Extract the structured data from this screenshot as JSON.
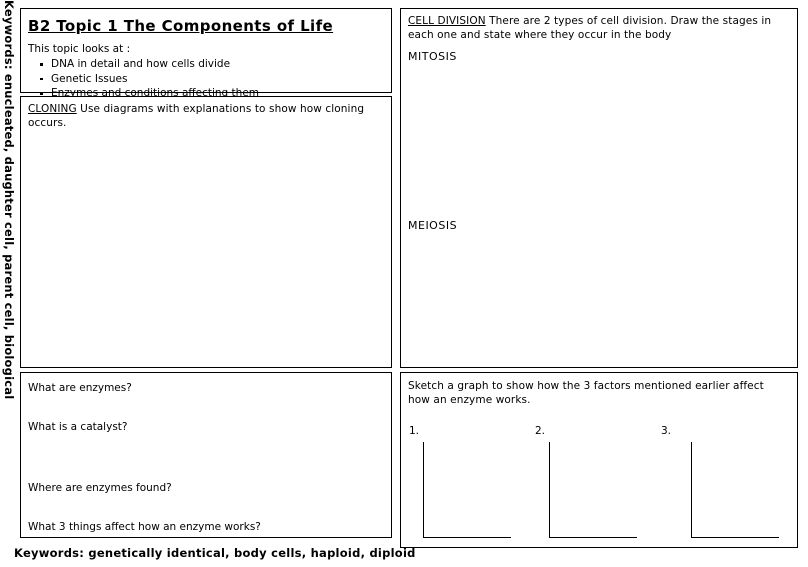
{
  "document": {
    "title": "B2 Topic 1 The Components of Life",
    "side_keywords": "Keywords: enucleated, daughter cell, parent cell, biological",
    "bottom_keywords": "Keywords: genetically identical, body cells, haploid, diploid"
  },
  "topic_box": {
    "heading": "B2 Topic 1 The Components of Life",
    "intro": "This topic looks at :",
    "bullets": [
      "DNA in detail and how cells divide",
      "Genetic Issues",
      "Enzymes and conditions affecting them"
    ]
  },
  "cloning_box": {
    "heading": "CLONING",
    "instruction": "Use diagrams with explanations to show how cloning occurs."
  },
  "cell_division_box": {
    "heading": "CELL DIVISION",
    "instruction": "There are 2 types of cell division. Draw the stages in each one and state where they occur in the body",
    "subsection_one": "MITOSIS",
    "subsection_two": "MEIOSIS"
  },
  "enzymes_box": {
    "questions": [
      "What are enzymes?",
      "What is a catalyst?",
      "Where are enzymes found?",
      "What 3 things affect how an enzyme works?"
    ]
  },
  "graph_box": {
    "instruction": "Sketch a graph to show how the 3 factors mentioned earlier affect how an enzyme works.",
    "axes": [
      {
        "number": "1."
      },
      {
        "number": "2."
      },
      {
        "number": "3."
      }
    ]
  },
  "colors": {
    "ink": "#000000",
    "paper": "#ffffff"
  }
}
